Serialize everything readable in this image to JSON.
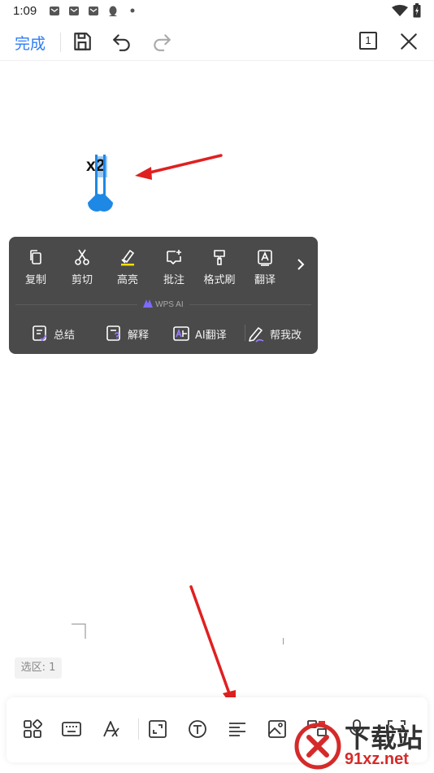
{
  "status_bar": {
    "time": "1:09",
    "notification_icons": [
      "mail-icon",
      "mail-icon",
      "mail-icon",
      "qq-icon",
      "dot-icon"
    ],
    "right_icons": [
      "wifi-icon",
      "battery-charging-icon"
    ]
  },
  "toolbar": {
    "done_label": "完成",
    "icons": [
      "save-icon",
      "undo-icon",
      "redo-icon",
      "page-view-icon",
      "close-icon"
    ],
    "page_number": "1"
  },
  "document": {
    "selected_text": "x2"
  },
  "context_menu": {
    "actions": [
      {
        "label": "复制",
        "icon": "copy-icon"
      },
      {
        "label": "剪切",
        "icon": "scissors-icon"
      },
      {
        "label": "高亮",
        "icon": "highlight-icon"
      },
      {
        "label": "批注",
        "icon": "comment-icon"
      },
      {
        "label": "格式刷",
        "icon": "format-painter-icon"
      },
      {
        "label": "翻译",
        "icon": "translate-icon"
      }
    ],
    "more_icon": "chevron-right-icon",
    "ai_section_label": "WPS AI",
    "ai_actions": [
      {
        "label": "总结",
        "icon": "summary-icon"
      },
      {
        "label": "解释",
        "icon": "explain-icon"
      },
      {
        "label": "AI翻译",
        "icon": "ai-translate-icon"
      },
      {
        "label": "帮我改",
        "icon": "pen-icon"
      }
    ],
    "colors": {
      "background": "#4a4a4a",
      "highlight": "#f5e000"
    }
  },
  "selection_badge": "选区: 1",
  "bottom_toolbar": {
    "icons": [
      "apps-icon",
      "keyboard-icon",
      "font-style-icon",
      "resize-icon",
      "text-box-icon",
      "align-left-icon",
      "image-icon",
      "layout-icon",
      "microphone-icon",
      "scan-icon"
    ]
  },
  "watermark": {
    "text_top": "下载站",
    "text_bottom": "91xz.net"
  },
  "colors": {
    "accent": "#2e7cf6",
    "annotation_arrow": "#e02020",
    "selection_handle": "#1e88e5"
  }
}
